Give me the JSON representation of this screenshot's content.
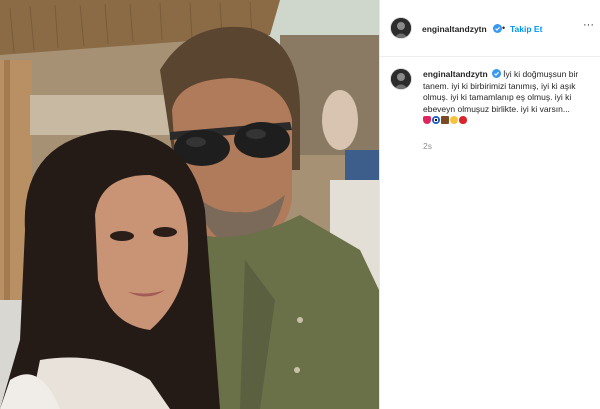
{
  "post": {
    "username": "enginaltandzytn",
    "follow_label": "Takip Et",
    "separator": "•",
    "more_label": "···",
    "caption": {
      "username": "enginaltandzytn",
      "text": "İyi ki doğmuşsun bir tanem. iyi ki birbirimizi tanımış, iyi ki aşık olmuş. iyi ki tamamlanıp eş olmuş. iyi ki ebeveyn olmuşuz birlikte. iyi ki varsın...",
      "emojis": [
        "red-heart",
        "nazar-amulet",
        "chocolate-bar",
        "face-with-tongue",
        "balloon"
      ]
    },
    "timestamp": "2s"
  },
  "colors": {
    "accent": "#0095f6",
    "verified": "#3897f0",
    "text": "#262626",
    "muted": "#8e8e8e"
  }
}
